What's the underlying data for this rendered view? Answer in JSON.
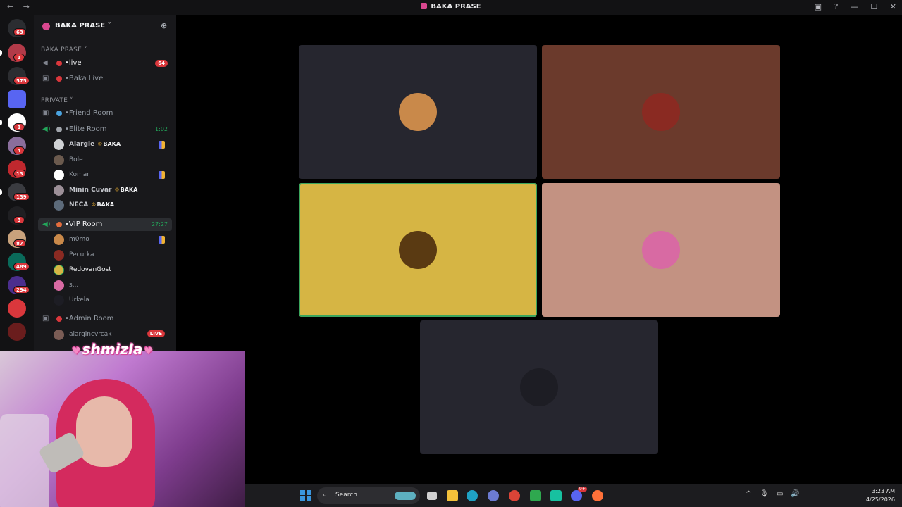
{
  "titlebar": {
    "title": "BAKA PRASE",
    "back": "←",
    "forward": "→",
    "inbox_icon": "inbox-icon",
    "help": "?",
    "minimize": "—",
    "maximize": "☐",
    "close": "✕"
  },
  "guilds": {
    "home_badge": "63",
    "items": [
      {
        "badge": "1",
        "color": "#b23a48"
      },
      {
        "badge": "575",
        "color": "#2c2d31"
      },
      {
        "badge": "",
        "color": "#5865f2"
      },
      {
        "badge": "1",
        "color": "#ffffff"
      },
      {
        "badge": "4",
        "color": "#8a6e9c"
      },
      {
        "badge": "13",
        "color": "#c0282e"
      },
      {
        "badge": "139",
        "color": "#3a3b40"
      },
      {
        "badge": "3",
        "color": "#1f1f22"
      },
      {
        "badge": "87",
        "color": "#c8a27c"
      },
      {
        "badge": "489",
        "color": "#0a6a5a"
      },
      {
        "badge": "294",
        "color": "#4b2e8e"
      },
      {
        "badge": "",
        "color": "#da373c"
      },
      {
        "badge": "",
        "color": "#6a1d1d"
      }
    ]
  },
  "sidebar": {
    "server_name": "BAKA PRASE ˅",
    "invite_icon": "add-member-icon",
    "cat_main": "BAKA PRASE ˅",
    "cat_private": "PRIVATE ˅",
    "live_channel": "•live",
    "live_count": "64",
    "baka_live": "•Baka Live",
    "friend_room": "•Friend Room",
    "elite_room": "•Elite Room",
    "elite_timer": "1:02",
    "elite_users": [
      {
        "name": "Alargie",
        "tag": "BAKA"
      },
      {
        "name": "Bole",
        "tag": ""
      },
      {
        "name": "Komar",
        "tag": ""
      },
      {
        "name": "Minin Cuvar",
        "tag": "BAKA"
      },
      {
        "name": "NECA",
        "tag": "BAKA"
      }
    ],
    "vip_room": "•VIP Room",
    "vip_timer": "27:27",
    "vip_users": [
      "m0mo",
      "Pecurka",
      "RedovanGost",
      "s...",
      "Urkela"
    ],
    "admin_room": "•Admin Room",
    "admin_user": "alargincvrcak",
    "live_badge": "LIVE"
  },
  "overlay": {
    "handle": "shmizla",
    "heart": "♥"
  },
  "stage": {
    "tiles": [
      {
        "bg": "#26262f",
        "avatar": "#c9894a"
      },
      {
        "bg": "#6b3a2c",
        "avatar": "#8a2a22"
      },
      {
        "bg": "#d6b544",
        "avatar": "#5a3a12"
      },
      {
        "bg": "#c39282",
        "avatar": "#d86aa3"
      },
      {
        "bg": "#26262f",
        "avatar": "#1d1d24"
      }
    ]
  },
  "taskbar": {
    "search_label": "Search",
    "search_icon": "⌕",
    "discord_badge": "9+",
    "time": "3:23 AM",
    "date": "4/25/2026",
    "chevron": "^",
    "mic": "🎙",
    "net": "▭",
    "vol": "🔊"
  }
}
